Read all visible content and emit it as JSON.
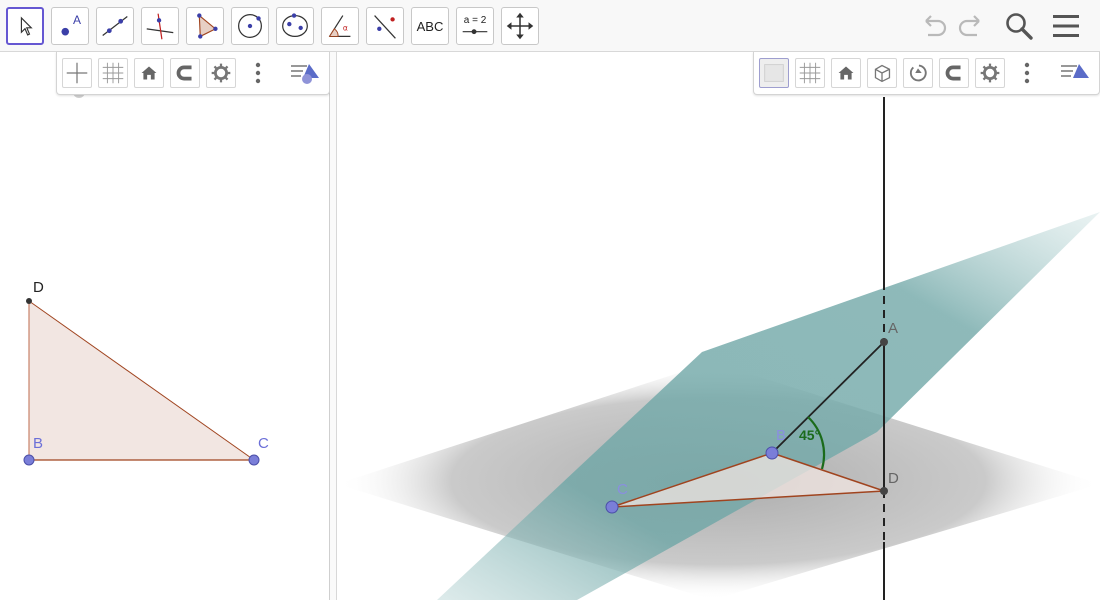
{
  "toolbar": {
    "tools": [
      {
        "name": "move-tool",
        "icon": "arrow-pointer-icon"
      },
      {
        "name": "point-tool",
        "icon": "point-icon",
        "label": "A"
      },
      {
        "name": "line-tool",
        "icon": "line-icon"
      },
      {
        "name": "perpendicular-line-tool",
        "icon": "perpendicular-icon"
      },
      {
        "name": "polygon-tool",
        "icon": "polygon-icon"
      },
      {
        "name": "circle-tool",
        "icon": "circle-center-icon"
      },
      {
        "name": "conic-tool",
        "icon": "ellipse-icon"
      },
      {
        "name": "angle-tool",
        "icon": "angle-icon"
      },
      {
        "name": "reflect-tool",
        "icon": "reflect-icon"
      },
      {
        "name": "text-tool",
        "icon": "text-icon",
        "label": "ABC"
      },
      {
        "name": "slider-tool",
        "icon": "slider-icon",
        "label": "a = 2"
      },
      {
        "name": "move-graphics-tool",
        "icon": "move-arrows-icon"
      }
    ],
    "right": [
      "undo-icon",
      "redo-icon",
      "search-icon",
      "menu-icon"
    ]
  },
  "view2d": {
    "points": {
      "D": "D",
      "B": "B",
      "C": "C"
    },
    "colors": {
      "fill": "#f2e6e2",
      "edge": "#a0441f",
      "free_point": "#6b6fd8"
    }
  },
  "view3d": {
    "labels": {
      "A": "A",
      "B": "B",
      "C": "C",
      "D": "D",
      "angle": "45°"
    },
    "colors": {
      "plane": "#7fb0b0",
      "ground": "#9a9a9a",
      "angle": "#1b6b1b",
      "edge": "#a0441f"
    }
  },
  "stylebar2d": [
    "axes-icon",
    "grid-icon",
    "home-icon",
    "magnet-icon",
    "gear-icon",
    "more-icon",
    "view-menu-icon"
  ],
  "stylebar3d": [
    "plane-icon",
    "grid-icon",
    "home-icon",
    "cube-view-icon",
    "rotate-icon",
    "magnet-icon",
    "gear-icon",
    "more-icon",
    "view-menu-icon"
  ]
}
